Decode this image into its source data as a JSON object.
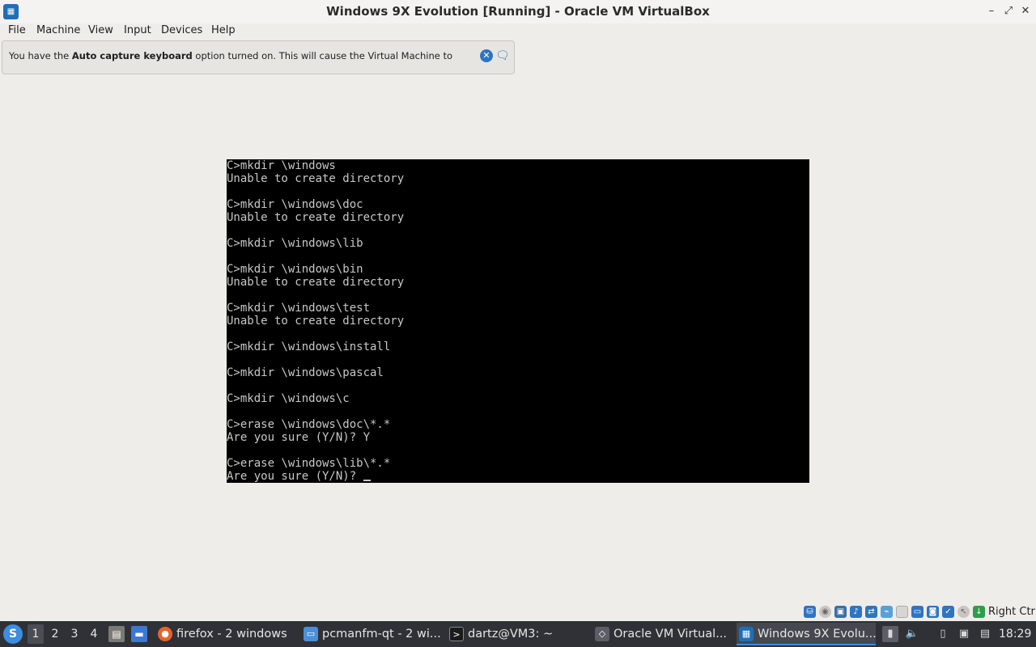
{
  "window": {
    "title": "Windows 9X Evolution [Running] - Oracle VM VirtualBox",
    "app_icon": "virtualbox-icon",
    "controls": {
      "minimize": "–",
      "restore": "⤢",
      "close": "✕"
    }
  },
  "menubar": {
    "items": [
      "File",
      "Machine",
      "View",
      "Input",
      "Devices",
      "Help"
    ]
  },
  "notification": {
    "text_before": "You have the ",
    "text_bold": "Auto capture keyboard",
    "text_after": " option turned on. This will cause the Virtual Machine to",
    "close_glyph": "✕",
    "do_not_show_glyph": "🗨"
  },
  "console": {
    "lines": [
      "C>mkdir \\windows",
      "Unable to create directory",
      "",
      "C>mkdir \\windows\\doc",
      "Unable to create directory",
      "",
      "C>mkdir \\windows\\lib",
      "",
      "C>mkdir \\windows\\bin",
      "Unable to create directory",
      "",
      "C>mkdir \\windows\\test",
      "Unable to create directory",
      "",
      "C>mkdir \\windows\\install",
      "",
      "C>mkdir \\windows\\pascal",
      "",
      "C>mkdir \\windows\\c",
      "",
      "C>erase \\windows\\doc\\*.*",
      "Are you sure (Y/N)? Y",
      "",
      "C>erase \\windows\\lib\\*.*"
    ],
    "prompt_line": "Are you sure (Y/N)? "
  },
  "vbox_status": {
    "icons": [
      "hard-disk-icon",
      "optical-drive-icon",
      "floppy-icon",
      "audio-icon",
      "network-icon",
      "usb-icon",
      "shared-folders-icon",
      "display-icon",
      "recording-icon",
      "vt-x-icon",
      "mouse-integration-icon",
      "host-key-icon"
    ],
    "host_key_label": "Right Ctrl"
  },
  "taskbar": {
    "desktops": [
      "1",
      "2",
      "3",
      "4"
    ],
    "active_desktop": "1",
    "tasks": [
      {
        "label": "firefox - 2 windows",
        "icon": "firefox-icon"
      },
      {
        "label": "pcmanfm-qt - 2 wi...",
        "icon": "folder-icon"
      },
      {
        "label": "dartz@VM3: ~",
        "icon": "terminal-icon"
      },
      {
        "label": "Oracle VM Virtual...",
        "icon": "virtualbox-icon"
      },
      {
        "label": "Windows 9X Evolu...",
        "icon": "virtualbox-icon"
      }
    ],
    "active_task": "Windows 9X Evolu...",
    "clock": "18:29"
  },
  "colors": {
    "accent": "#3d8de0",
    "console_bg": "#000000",
    "console_fg": "#c8c8c8",
    "taskbar_bg": "#2f3136"
  }
}
